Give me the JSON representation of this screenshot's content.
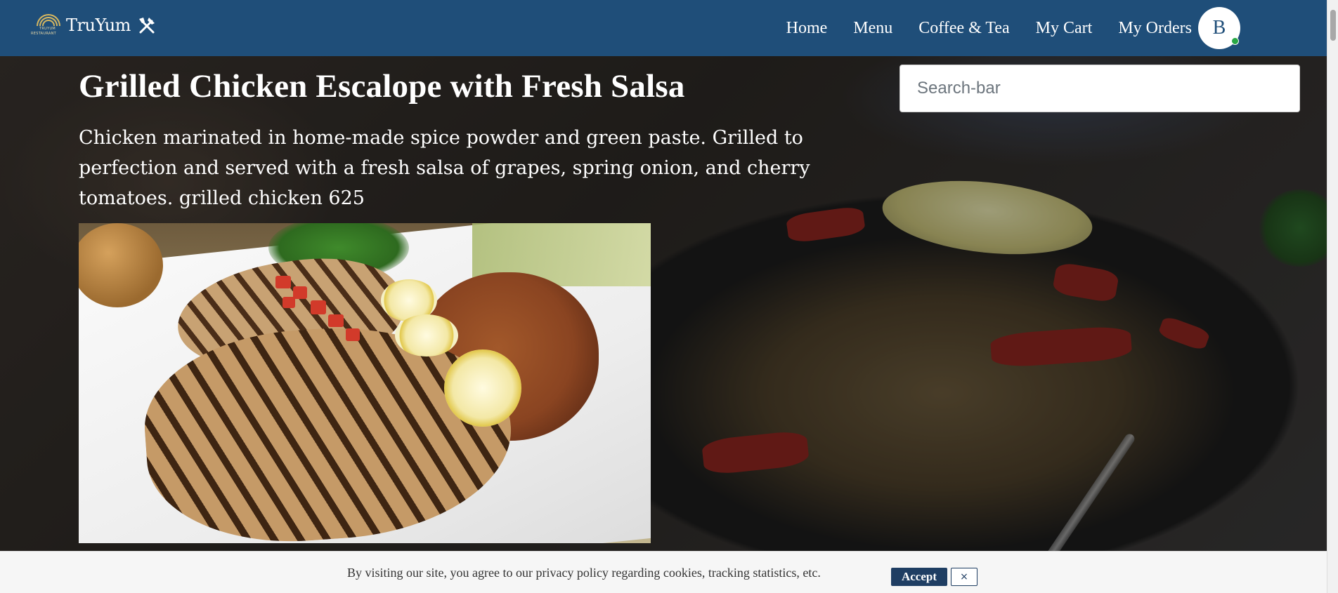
{
  "navbar": {
    "brand_name": "TruYum",
    "logo_line1": "TRUYUM",
    "logo_line2": "RESTAURANT",
    "links": [
      "Home",
      "Menu",
      "Coffee & Tea",
      "My Cart",
      "My Orders"
    ],
    "avatar_initial": "B",
    "background_color": "#1f4e79"
  },
  "search": {
    "placeholder": "Search-bar",
    "value": ""
  },
  "item": {
    "title": "Grilled Chicken Escalope with Fresh Salsa",
    "description": "Chicken marinated in home-made spice powder and green paste. Grilled to perfection and served with a fresh salsa of grapes, spring onion, and cherry tomatoes. grilled chicken 625",
    "image_icon": "grilled-chicken-photo"
  },
  "cookie_banner": {
    "text": "By visiting our site, you agree to our privacy policy regarding cookies, tracking statistics, etc.",
    "accept_label": "Accept",
    "close_label": "×",
    "accent_color": "#1f3e63"
  },
  "icons": {
    "brand_icon": "fork-knife-icon",
    "online_status": "online-dot"
  }
}
